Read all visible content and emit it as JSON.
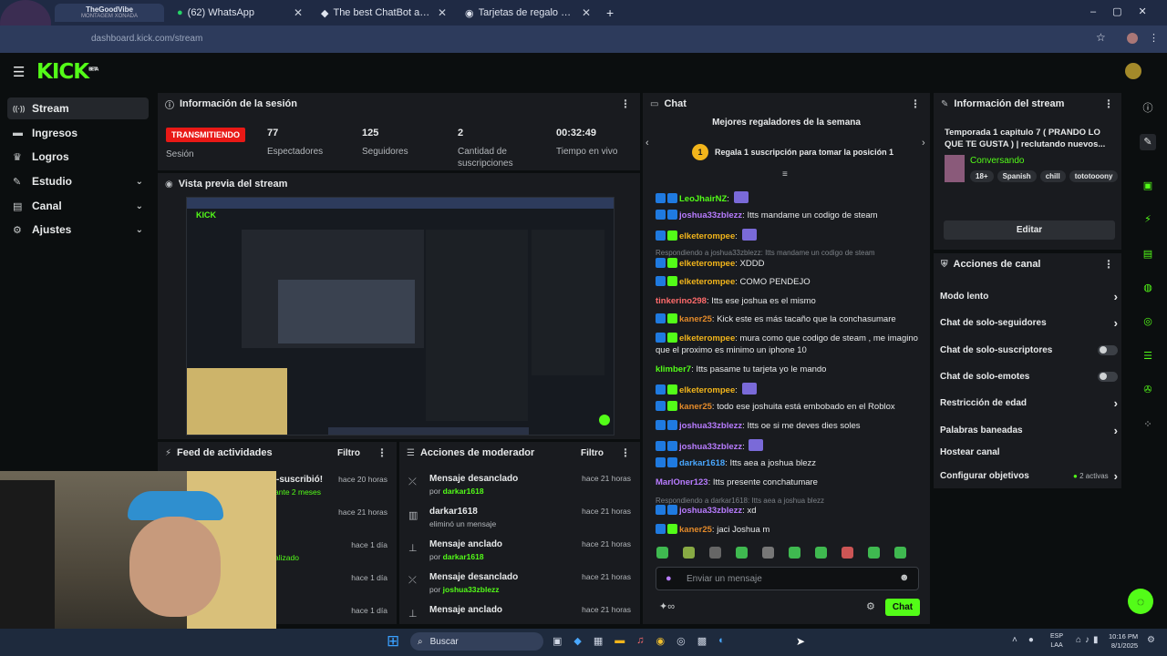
{
  "browser": {
    "tabs": [
      {
        "title": "TheGoodVibe",
        "sub": "MONTAGEM XONADA"
      },
      {
        "title": "(62) WhatsApp"
      },
      {
        "title": "The best ChatBot and Widgets"
      },
      {
        "title": "Tarjetas de regalo de Steam"
      }
    ],
    "url": "dashboard.kick.com/stream"
  },
  "brand": {
    "logo": "KICK",
    "beta": "BETA",
    "accent": "#53fc18"
  },
  "sidebar": {
    "items": [
      {
        "label": "Stream",
        "icon": "broadcast-icon"
      },
      {
        "label": "Ingresos",
        "icon": "card-icon"
      },
      {
        "label": "Logros",
        "icon": "trophy-icon"
      },
      {
        "label": "Estudio",
        "icon": "pen-icon"
      },
      {
        "label": "Canal",
        "icon": "layout-icon"
      },
      {
        "label": "Ajustes",
        "icon": "gear-icon"
      }
    ]
  },
  "session": {
    "title": "Información de la sesión",
    "live": "TRANSMITIENDO",
    "live_label": "Sesión",
    "stats": [
      {
        "n": "77",
        "l": "Espectadores"
      },
      {
        "n": "125",
        "l": "Seguidores"
      },
      {
        "n": "2",
        "l": "Cantidad de suscripciones"
      },
      {
        "n": "00:32:49",
        "l": "Tiempo en vivo"
      }
    ]
  },
  "preview": {
    "title": "Vista previa del stream"
  },
  "feed": {
    "title": "Feed de actividades",
    "filter": "Filtro",
    "items": [
      {
        "t": "-suscribió!",
        "s": "ante 2 meses",
        "h": "hace 20 horas"
      },
      {
        "t": "",
        "s": "",
        "h": "hace 21 horas"
      },
      {
        "t": "",
        "s": "alizado",
        "h": "hace 1 día"
      },
      {
        "t": "",
        "s": "",
        "h": "hace 1 día"
      },
      {
        "t": "",
        "s": "",
        "h": "hace 1 día"
      }
    ]
  },
  "mod": {
    "title": "Acciones de moderador",
    "filter": "Filtro",
    "items": [
      {
        "t": "Mensaje desanclado",
        "p": "por",
        "u": "darkar1618",
        "h": "hace 21 horas"
      },
      {
        "t": "darkar1618",
        "p": "",
        "u": "eliminó un mensaje",
        "h": "hace 21 horas"
      },
      {
        "t": "Mensaje anclado",
        "p": "por",
        "u": "darkar1618",
        "h": "hace 21 horas"
      },
      {
        "t": "Mensaje desanclado",
        "p": "por",
        "u": "joshua33zblezz",
        "h": "hace 21 horas"
      },
      {
        "t": "Mensaje anclado",
        "p": "",
        "u": "",
        "h": "hace 21 horas"
      }
    ]
  },
  "chat": {
    "title": "Chat",
    "gifters_title": "Mejores regaladores de la semana",
    "gift_text": "Regala 1 suscripción para tomar la posición 1",
    "gift_rank": "1",
    "input_placeholder": "Enviar un mensaje",
    "send": "Chat",
    "messages": [
      {
        "u": "LeoJhairNZ",
        "c": "ug",
        "b": "bb",
        "m": ""
      },
      {
        "u": "joshua33zblezz",
        "c": "up",
        "b": "bb",
        "m": "Itts mandame un codigo de steam"
      },
      {
        "u": "elketerompee",
        "c": "uy",
        "b": "bg",
        "m": ""
      },
      {
        "reply": "Respondiendo a joshua33zblezz: Itts mandame un codigo de steam"
      },
      {
        "u": "elketerompee",
        "c": "uy",
        "b": "bg",
        "m": "XDDD"
      },
      {
        "u": "elketerompee",
        "c": "uy",
        "b": "bg",
        "m": "COMO PENDEJO"
      },
      {
        "u": "tinkerino298",
        "c": "ur",
        "b": "",
        "m": "Itts ese joshua es el mismo"
      },
      {
        "u": "kaner25",
        "c": "uo",
        "b": "bg",
        "m": "Kick este es más tacaño que la conchasumare"
      },
      {
        "u": "elketerompee",
        "c": "uy",
        "b": "bg",
        "m": "mura como que codigo de steam , me imagino que el proximo es minimo un iphone 10"
      },
      {
        "u": "klimber7",
        "c": "ug",
        "b": "",
        "m": "Itts pasame tu tarjeta yo le mando"
      },
      {
        "u": "elketerompee",
        "c": "uy",
        "b": "bg",
        "m": ""
      },
      {
        "u": "kaner25",
        "c": "uo",
        "b": "bg",
        "m": "todo ese joshuita está embobado en el Roblox"
      },
      {
        "u": "joshua33zblezz",
        "c": "up",
        "b": "bb",
        "m": "Itts oe si me deves dies soles"
      },
      {
        "u": "joshua33zblezz",
        "c": "up",
        "b": "bb",
        "m": ""
      },
      {
        "u": "darkar1618",
        "c": "ub",
        "b": "bb",
        "m": "Itts aea a joshua blezz"
      },
      {
        "u": "MarlOner123",
        "c": "up",
        "b": "",
        "m": "Itts presente conchatumare"
      },
      {
        "reply": "Respondiendo a darkar1618: Itts aea a joshua blezz"
      },
      {
        "u": "joshua33zblezz",
        "c": "up",
        "b": "bb",
        "m": "xd"
      },
      {
        "u": "kaner25",
        "c": "uo",
        "b": "bg",
        "m": "jaci Joshua m"
      }
    ]
  },
  "streaminfo": {
    "title": "Información del stream",
    "stream_title": "Temporada 1 capitulo 7 ( PRANDO LO QUE TE GUSTA ) | reclutando nuevos...",
    "category": "Conversando",
    "tags": [
      "18+",
      "Spanish",
      "chill",
      "tototooony"
    ],
    "edit": "Editar"
  },
  "actions": {
    "title": "Acciones de canal",
    "items": [
      {
        "l": "Modo lento",
        "k": "chev"
      },
      {
        "l": "Chat de solo-seguidores",
        "k": "chev"
      },
      {
        "l": "Chat de solo-suscriptores",
        "k": "toggle"
      },
      {
        "l": "Chat de solo-emotes",
        "k": "toggle"
      },
      {
        "l": "Restricción de edad",
        "k": "chev"
      },
      {
        "l": "Palabras baneadas",
        "k": "chev"
      },
      {
        "l": "Hostear canal",
        "k": ""
      },
      {
        "l": "Configurar objetivos",
        "k": "chev",
        "extra": "2 activas"
      }
    ]
  },
  "taskbar": {
    "search": "Buscar",
    "lang": "ESP",
    "lang2": "LAA",
    "time": "10:16 PM",
    "date": "8/1/2025"
  }
}
